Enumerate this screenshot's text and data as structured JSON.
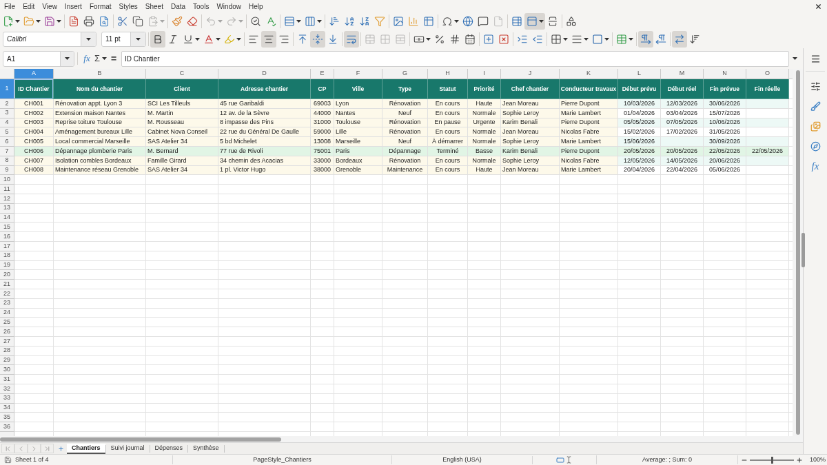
{
  "menu_bar": [
    "File",
    "Edit",
    "View",
    "Insert",
    "Format",
    "Styles",
    "Sheet",
    "Data",
    "Tools",
    "Window",
    "Help"
  ],
  "standard_toolbar": [
    [
      {
        "kind": "new",
        "pressed": false,
        "disabled": false
      },
      {
        "kind": "open",
        "pressed": false,
        "disabled": false
      },
      {
        "kind": "save",
        "pressed": false,
        "disabled": false
      }
    ],
    [
      {
        "kind": "export_pdf",
        "pressed": false,
        "disabled": false
      },
      {
        "kind": "print",
        "pressed": false,
        "disabled": false
      },
      {
        "kind": "print_preview",
        "pressed": false,
        "disabled": false
      }
    ],
    [
      {
        "kind": "cut",
        "pressed": false,
        "disabled": false
      },
      {
        "kind": "copy",
        "pressed": false,
        "disabled": false
      },
      {
        "kind": "paste",
        "pressed": false,
        "disabled": true
      }
    ],
    [
      {
        "kind": "clone_formatting",
        "pressed": false,
        "disabled": false
      },
      {
        "kind": "clear_formatting",
        "pressed": false,
        "disabled": false
      }
    ],
    [
      {
        "kind": "undo",
        "pressed": false,
        "disabled": true
      },
      {
        "kind": "redo",
        "pressed": false,
        "disabled": true
      }
    ],
    [
      {
        "kind": "find_replace",
        "pressed": false,
        "disabled": false
      },
      {
        "kind": "spelling",
        "pressed": false,
        "disabled": false
      }
    ],
    [
      {
        "kind": "rows",
        "pressed": false,
        "disabled": false
      },
      {
        "kind": "columns",
        "pressed": false,
        "disabled": false
      }
    ],
    [
      {
        "kind": "sort",
        "pressed": false,
        "disabled": false
      },
      {
        "kind": "sort_ascending",
        "pressed": false,
        "disabled": false
      },
      {
        "kind": "sort_descending",
        "pressed": false,
        "disabled": false
      },
      {
        "kind": "autofilter",
        "pressed": false,
        "disabled": false
      }
    ],
    [
      {
        "kind": "image",
        "pressed": false,
        "disabled": false
      },
      {
        "kind": "chart",
        "pressed": false,
        "disabled": false
      },
      {
        "kind": "pivot_table",
        "pressed": false,
        "disabled": false
      }
    ],
    [
      {
        "kind": "special_character",
        "pressed": false,
        "disabled": false
      },
      {
        "kind": "hyperlink",
        "pressed": false,
        "disabled": false
      },
      {
        "kind": "comment",
        "pressed": false,
        "disabled": false
      },
      {
        "kind": "header_footer",
        "pressed": false,
        "disabled": true
      }
    ],
    [
      {
        "kind": "print_area",
        "pressed": false,
        "disabled": false
      },
      {
        "kind": "freeze",
        "pressed": true,
        "disabled": false
      },
      {
        "kind": "split_window",
        "pressed": false,
        "disabled": false
      }
    ],
    [
      {
        "kind": "shapes",
        "pressed": false,
        "disabled": false
      }
    ]
  ],
  "formatting_toolbar": {
    "font_name": "Calibri",
    "font_size": "11 pt",
    "groups": [
      [
        {
          "kind": "bold",
          "pressed": true,
          "disabled": false
        },
        {
          "kind": "italic",
          "pressed": false,
          "disabled": false
        },
        {
          "kind": "underline",
          "pressed": false,
          "disabled": false
        },
        {
          "kind": "font_color",
          "pressed": false,
          "disabled": false
        },
        {
          "kind": "highlight",
          "pressed": false,
          "disabled": false
        }
      ],
      [
        {
          "kind": "align_left",
          "pressed": false,
          "disabled": false
        },
        {
          "kind": "align_center",
          "pressed": true,
          "disabled": false
        },
        {
          "kind": "align_right",
          "pressed": false,
          "disabled": false
        }
      ],
      [
        {
          "kind": "align_top",
          "pressed": false,
          "disabled": false
        },
        {
          "kind": "align_middle",
          "pressed": true,
          "disabled": false
        },
        {
          "kind": "align_bottom",
          "pressed": false,
          "disabled": false
        }
      ],
      [
        {
          "kind": "wrap_text",
          "pressed": true,
          "disabled": false
        }
      ],
      [
        {
          "kind": "merge_center",
          "pressed": false,
          "disabled": true
        },
        {
          "kind": "merge",
          "pressed": false,
          "disabled": true
        },
        {
          "kind": "unmerge",
          "pressed": false,
          "disabled": true
        }
      ],
      [
        {
          "kind": "currency",
          "pressed": false,
          "disabled": false
        },
        {
          "kind": "percent",
          "pressed": false,
          "disabled": false
        },
        {
          "kind": "number",
          "pressed": false,
          "disabled": false
        },
        {
          "kind": "date",
          "pressed": false,
          "disabled": false
        }
      ],
      [
        {
          "kind": "add_decimal",
          "pressed": false,
          "disabled": false
        },
        {
          "kind": "delete_decimal",
          "pressed": false,
          "disabled": false
        }
      ],
      [
        {
          "kind": "indent_increase",
          "pressed": false,
          "disabled": false
        },
        {
          "kind": "indent_decrease",
          "pressed": false,
          "disabled": false
        }
      ],
      [
        {
          "kind": "borders",
          "pressed": false,
          "disabled": false
        },
        {
          "kind": "border_style",
          "pressed": false,
          "disabled": false
        },
        {
          "kind": "border_color",
          "pressed": false,
          "disabled": false
        }
      ],
      [
        {
          "kind": "conditional",
          "pressed": false,
          "disabled": false
        }
      ],
      [
        {
          "kind": "ltr",
          "pressed": true,
          "disabled": false
        },
        {
          "kind": "rtl",
          "pressed": false,
          "disabled": false
        }
      ],
      [
        {
          "kind": "text_direction",
          "pressed": true,
          "disabled": false
        },
        {
          "kind": "vertical_text",
          "pressed": false,
          "disabled": false
        }
      ]
    ]
  },
  "formula_bar": {
    "name_box": "A1",
    "function_wizard": "fx",
    "sum": "Σ",
    "equals": "=",
    "formula": "ID Chantier"
  },
  "sheet": {
    "columns": [
      {
        "label": "A",
        "selected": true
      },
      {
        "label": "B",
        "selected": false
      },
      {
        "label": "C",
        "selected": false
      },
      {
        "label": "D",
        "selected": false
      },
      {
        "label": "E",
        "selected": false
      },
      {
        "label": "F",
        "selected": false
      },
      {
        "label": "G",
        "selected": false
      },
      {
        "label": "H",
        "selected": false
      },
      {
        "label": "I",
        "selected": false
      },
      {
        "label": "J",
        "selected": false
      },
      {
        "label": "K",
        "selected": false
      },
      {
        "label": "L",
        "selected": false
      },
      {
        "label": "M",
        "selected": false
      },
      {
        "label": "N",
        "selected": false
      },
      {
        "label": "O",
        "selected": false
      }
    ],
    "header_row": {
      "number": "1",
      "selected": true,
      "cells": [
        "ID Chantier",
        "Nom du chantier",
        "Client",
        "Adresse chantier",
        "CP",
        "Ville",
        "Type",
        "Statut",
        "Priorité",
        "Chef chantier",
        "Conducteur travaux",
        "Début prévu",
        "Début réel",
        "Fin prévue",
        "Fin réelle"
      ]
    },
    "rows": [
      {
        "number": "2",
        "selected": false,
        "highlighted": false,
        "cells": [
          "CH001",
          "Rénovation appt. Lyon 3",
          "SCI Les Tilleuls",
          "45 rue Garibaldi",
          "69003",
          "Lyon",
          "Rénovation",
          "En cours",
          "Haute",
          "Jean Moreau",
          "Pierre Dupont",
          "10/03/2026",
          "12/03/2026",
          "30/06/2026"
        ]
      },
      {
        "number": "3",
        "selected": false,
        "highlighted": false,
        "cells": [
          "CH002",
          "Extension maison Nantes",
          "M. Martin",
          "12 av. de la Sèvre",
          "44000",
          "Nantes",
          "Neuf",
          "En cours",
          "Normale",
          "Sophie Leroy",
          "Marie Lambert",
          "01/04/2026",
          "03/04/2026",
          "15/07/2026"
        ]
      },
      {
        "number": "4",
        "selected": false,
        "highlighted": false,
        "cells": [
          "CH003",
          "Reprise toiture Toulouse",
          "M. Rousseau",
          "8 impasse des Pins",
          "31000",
          "Toulouse",
          "Rénovation",
          "En pause",
          "Urgente",
          "Karim Benali",
          "Pierre Dupont",
          "05/05/2026",
          "07/05/2026",
          "10/06/2026"
        ]
      },
      {
        "number": "5",
        "selected": false,
        "highlighted": false,
        "cells": [
          "CH004",
          "Aménagement bureaux Lille",
          "Cabinet Nova Conseil",
          "22 rue du Général De Gaulle",
          "59000",
          "Lille",
          "Rénovation",
          "En cours",
          "Normale",
          "Jean Moreau",
          "Nicolas Fabre",
          "15/02/2026",
          "17/02/2026",
          "31/05/2026"
        ]
      },
      {
        "number": "6",
        "selected": false,
        "highlighted": false,
        "cells": [
          "CH005",
          "Local commercial Marseille",
          "SAS Atelier 34",
          "5 bd Michelet",
          "13008",
          "Marseille",
          "Neuf",
          "À démarrer",
          "Normale",
          "Sophie Leroy",
          "Marie Lambert",
          "15/06/2026",
          null,
          "30/09/2026"
        ]
      },
      {
        "number": "7",
        "selected": false,
        "highlighted": true,
        "cells": [
          "CH006",
          "Dépannage plomberie Paris",
          "M. Bernard",
          "77 rue de Rivoli",
          "75001",
          "Paris",
          "Dépannage",
          "Terminé",
          "Basse",
          "Karim Benali",
          "Pierre Dupont",
          "20/05/2026",
          "20/05/2026",
          "22/05/2026",
          "22/05/2026"
        ]
      },
      {
        "number": "8",
        "selected": false,
        "highlighted": false,
        "cells": [
          "CH007",
          "Isolation combles Bordeaux",
          "Famille Girard",
          "34 chemin des Acacias",
          "33000",
          "Bordeaux",
          "Rénovation",
          "En cours",
          "Normale",
          "Sophie Leroy",
          "Nicolas Fabre",
          "12/05/2026",
          "14/05/2026",
          "20/06/2026"
        ]
      },
      {
        "number": "9",
        "selected": false,
        "highlighted": false,
        "cells": [
          "CH008",
          "Maintenance réseau Grenoble",
          "SAS Atelier 34",
          "1 pl. Victor Hugo",
          "38000",
          "Grenoble",
          "Maintenance",
          "En cours",
          "Haute",
          "Jean Moreau",
          "Marie Lambert",
          "20/04/2026",
          "22/04/2026",
          "05/06/2026"
        ]
      }
    ],
    "empty_rows": [
      "10",
      "11",
      "12",
      "13",
      "14",
      "15",
      "16",
      "17",
      "18",
      "19",
      "20",
      "21",
      "22",
      "23",
      "24",
      "25",
      "26",
      "27",
      "28",
      "29",
      "30",
      "31",
      "32",
      "33",
      "34",
      "35",
      "36"
    ]
  },
  "sheet_tabs": [
    {
      "label": "Chantiers",
      "selected": true
    },
    {
      "label": "Suivi journal",
      "selected": false
    },
    {
      "label": "Dépenses",
      "selected": false
    },
    {
      "label": "Synthèse",
      "selected": false
    }
  ],
  "sidebar": {
    "functions": "fx"
  },
  "status_bar": {
    "sheet": "Sheet 1 of 4",
    "page_style": "PageStyle_Chantiers",
    "language": "English (USA)",
    "summary": "Average: ; Sum: 0",
    "zoom": {
      "level": 0.5,
      "reading": "100%"
    }
  }
}
